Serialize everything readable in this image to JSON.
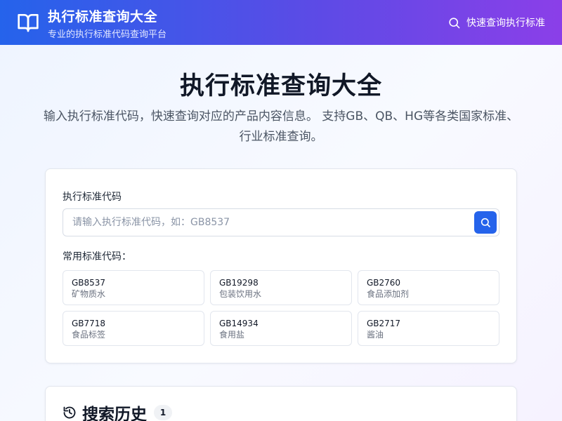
{
  "header": {
    "title": "执行标准查询大全",
    "subtitle": "专业的执行标准代码查询平台",
    "logo_icon": "book-open-icon",
    "quick_search_label": "快速查询执行标准",
    "quick_search_icon": "search-icon"
  },
  "hero": {
    "title": "执行标准查询大全",
    "description": "输入执行标准代码，快速查询对应的产品内容信息。 支持GB、QB、HG等各类国家标准、行业标准查询。"
  },
  "search": {
    "label": "执行标准代码",
    "value": "",
    "placeholder": "请输入执行标准代码，如：GB8537",
    "button_icon": "search-icon"
  },
  "common": {
    "label": "常用标准代码：",
    "items": [
      {
        "code": "GB8537",
        "name": "矿物质水"
      },
      {
        "code": "GB19298",
        "name": "包装饮用水"
      },
      {
        "code": "GB2760",
        "name": "食品添加剂"
      },
      {
        "code": "GB7718",
        "name": "食品标签"
      },
      {
        "code": "GB14934",
        "name": "食用盐"
      },
      {
        "code": "GB2717",
        "name": "酱油"
      }
    ]
  },
  "history": {
    "icon": "history-icon",
    "title": "搜索历史",
    "count": "1"
  },
  "colors": {
    "accent": "#2563eb",
    "header_gradient_start": "#2563eb",
    "header_gradient_end": "#8b3fe8"
  }
}
